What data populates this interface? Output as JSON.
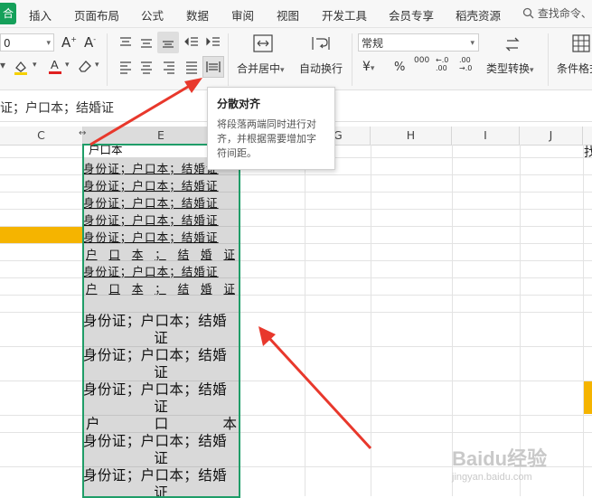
{
  "menu": {
    "home_partial": "合",
    "items": [
      "插入",
      "页面布局",
      "公式",
      "数据",
      "审阅",
      "视图",
      "开发工具",
      "会员专享",
      "稻壳资源"
    ],
    "search": "查找命令、"
  },
  "ribbon": {
    "font_size_value": "0",
    "merge_center": "合并居中",
    "wrap_text": "自动换行",
    "number_format": "常规",
    "type_convert": "类型转换",
    "conditional_partial": "条件格式",
    "currency_symbol": "¥",
    "percent_symbol": "%",
    "thousands_symbol": "000",
    "inc_decimal_symbol": "←.0 .00",
    "dec_decimal_symbol": ".00 →.0"
  },
  "formula_bar": {
    "content": "证；户口本；结婚证"
  },
  "columns": [
    "C",
    "E",
    "G",
    "H",
    "I",
    "J"
  ],
  "partial_cell_text": "户口本",
  "tooltip": {
    "title": "分散对齐",
    "body": [
      "将段落两端同时进行对",
      "齐，并根据需要增加字",
      "符间距。"
    ]
  },
  "cells_small": [
    "身份证；户口本；结婚证",
    "身份证；户口本；结婚证",
    "身份证；户口本；结婚证",
    "身份证；户口本；结婚证",
    "身份证；户口本；结婚证"
  ],
  "row_distributed_1": [
    "户",
    "口",
    "本",
    "；",
    "结",
    "婚",
    "证"
  ],
  "cell_small_6": "身份证；户口本；结婚证",
  "row_distributed_2": [
    "户",
    "口",
    "本",
    "；",
    "结",
    "婚",
    "证"
  ],
  "cells_large": [
    {
      "line1": "身份证；户口本；结婚",
      "line2": "证"
    },
    {
      "line1": "身份证；户口本；结婚",
      "line2": "证"
    },
    {
      "line1": "身份证；户口本；结婚",
      "line2": "证"
    }
  ],
  "row_distributed_large": [
    "户",
    "口",
    "本"
  ],
  "cells_large_2": [
    {
      "line1": "身份证；户口本；结婚",
      "line2": "证"
    },
    {
      "line1": "身份证；户口本；结婚",
      "line2": "证"
    }
  ],
  "right_edge_partial": "找",
  "watermark": {
    "brand": "Baidu经验",
    "url": "jingyan.baidu.com"
  },
  "colors": {
    "selection_border": "#1f9d68",
    "highlight": "#f5b400",
    "arrow": "#e8382c",
    "cell_fill": "#d9d9d9"
  }
}
